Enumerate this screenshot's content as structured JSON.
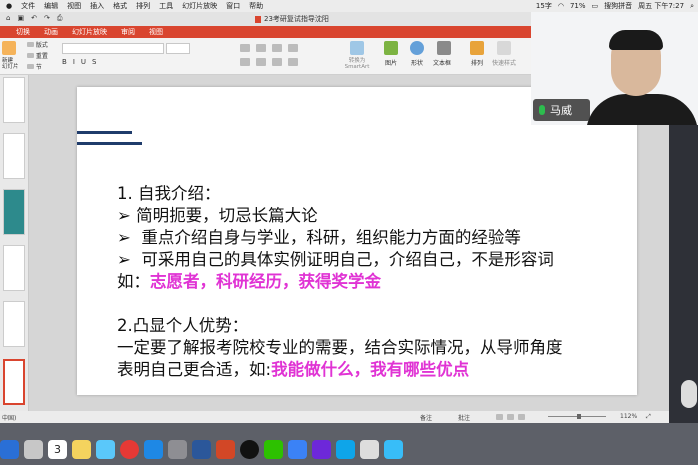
{
  "menubar": {
    "items": [
      "文件",
      "编辑",
      "视图",
      "插入",
      "格式",
      "排列",
      "工具",
      "幻灯片放映",
      "窗口",
      "帮助"
    ],
    "input_method": "15字",
    "battery": "71%",
    "ime_name": "搜狗拼音",
    "clock": "周五 下午7:27"
  },
  "window": {
    "title": "23考研复试指导沈阳"
  },
  "ribbon": {
    "tabs": [
      "切换",
      "动画",
      "幻灯片放映",
      "审阅",
      "视图"
    ],
    "new_slide": "新建\n幻灯片",
    "slide_labels": [
      "版式",
      "重置",
      "节"
    ],
    "buttons": [
      "转换为\nSmartArt",
      "图片",
      "形状",
      "文本框",
      "排列",
      "快速样式"
    ]
  },
  "slide": {
    "heading1": "1. 自我介绍：",
    "bullets": [
      "简明扼要，切忌长篇大论",
      "重点介绍自身与学业，科研，组织能力方面的经验等",
      "可采用自己的具体实例证明自己，介绍自己，不是形容词"
    ],
    "example_prefix": "如：",
    "example_highlight": "志愿者，科研经历，获得奖学金",
    "heading2": "2.凸显个人优势：",
    "para1": "一定要了解报考院校专业的需要，结合实际情况，从导师角度",
    "para2_prefix": "表明自己更合适，如:",
    "para2_highlight": "我能做什么，我有哪些优点",
    "bullet_glyph": "➢"
  },
  "statusbar": {
    "language": "中国)",
    "notes": "备注",
    "comments": "批注",
    "zoom": "112%"
  },
  "video": {
    "participant_name": "马威"
  },
  "colors": {
    "ribbon": "#d9452f",
    "highlight": "#e033d4",
    "accent_bar": "#1f3c6b"
  },
  "dock": {
    "calendar_day": "3",
    "apps": [
      "finder-app",
      "launchpad-app",
      "calendar-app",
      "notes-app",
      "photos-app",
      "chrome-app",
      "appstore-app",
      "settings-app",
      "word-app",
      "powerpoint-app",
      "qq-app",
      "wechat-app",
      "meeting-app",
      "other-app"
    ]
  }
}
